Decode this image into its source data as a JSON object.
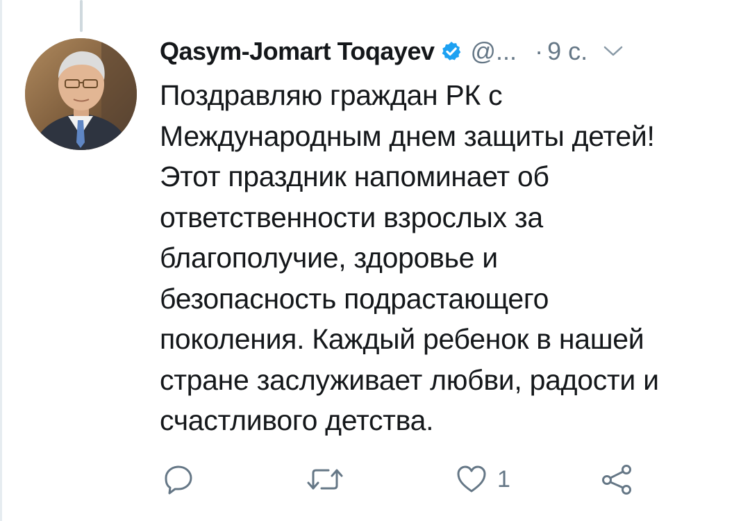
{
  "tweet": {
    "author": {
      "display_name": "Qasym-Jomart Toqayev",
      "handle": "@...",
      "verified": true,
      "avatar_icon": "profile-photo"
    },
    "separator": "·",
    "timestamp": "9 с.",
    "text_lines": [
      "Поздравляю граждан РК с",
      "Международным днем защиты детей!",
      "Этот праздник напоминает об",
      "ответственности взрослых за",
      "благополучие, здоровье и",
      "безопасность подрастающего",
      "поколения. Каждый ребенок в нашей",
      "стране заслуживает любви, радости и",
      "счастливого детства."
    ],
    "actions": {
      "reply_icon": "reply-icon",
      "retweet_icon": "retweet-icon",
      "like_icon": "heart-icon",
      "like_count": "1",
      "share_icon": "share-icon"
    }
  },
  "colors": {
    "text": "#14171a",
    "secondary": "#657786",
    "verified": "#1da1f2",
    "thread_line": "#cfd9de"
  }
}
